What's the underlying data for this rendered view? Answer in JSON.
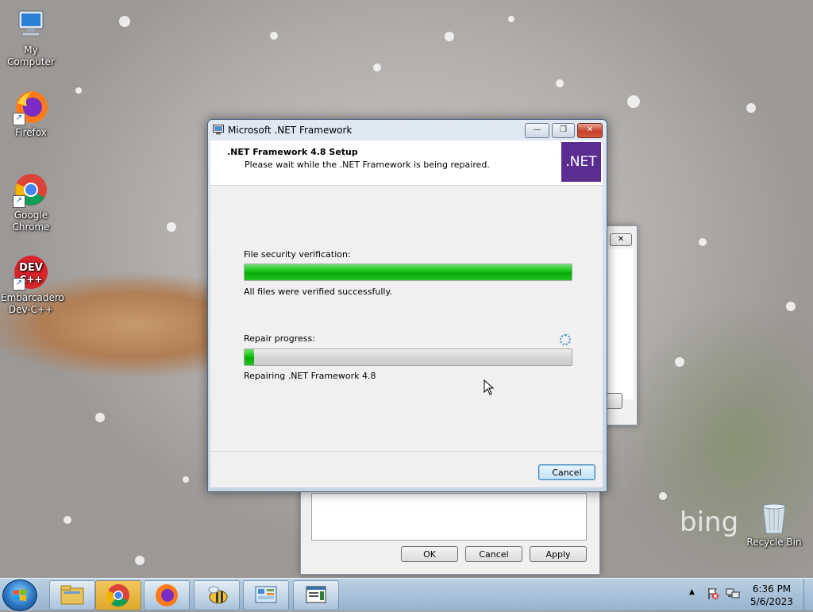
{
  "desktop": {
    "icons": [
      {
        "label": "My Computer"
      },
      {
        "label": "Firefox"
      },
      {
        "label": "Google Chrome"
      },
      {
        "label": "Embarcadero Dev-C++"
      },
      {
        "label": "Recycle Bin"
      }
    ],
    "wallpaper_brand": "bing"
  },
  "background_dialog": {
    "ok_label": "OK",
    "cancel_label": "Cancel",
    "apply_label": "Apply",
    "close_glyph": "✕"
  },
  "dialog": {
    "title": "Microsoft .NET Framework",
    "header_title": ".NET Framework 4.8 Setup",
    "header_subtitle": "Please wait while the .NET Framework is being repaired.",
    "logo_text": ".NET",
    "verification_label": "File security verification:",
    "verification_progress": 1.0,
    "verification_status": "All files were verified successfully.",
    "repair_label": "Repair progress:",
    "repair_progress": 0.03,
    "repair_status": "Repairing .NET Framework 4.8",
    "cancel_label": "Cancel",
    "minimize_glyph": "—",
    "restore_glyph": "❐",
    "close_glyph": "✕"
  },
  "taskbar": {
    "items": [
      "start",
      "file-explorer",
      "google-chrome",
      "firefox",
      "bee-app",
      "control-panel",
      "dotnet-setup"
    ],
    "tray_time": "6:36 PM",
    "tray_date": "5/6/2023",
    "tray_arrow": "▲"
  },
  "colors": {
    "net_purple": "#5c2d91",
    "progress_green": "#13c013",
    "close_red": "#c2412b"
  }
}
